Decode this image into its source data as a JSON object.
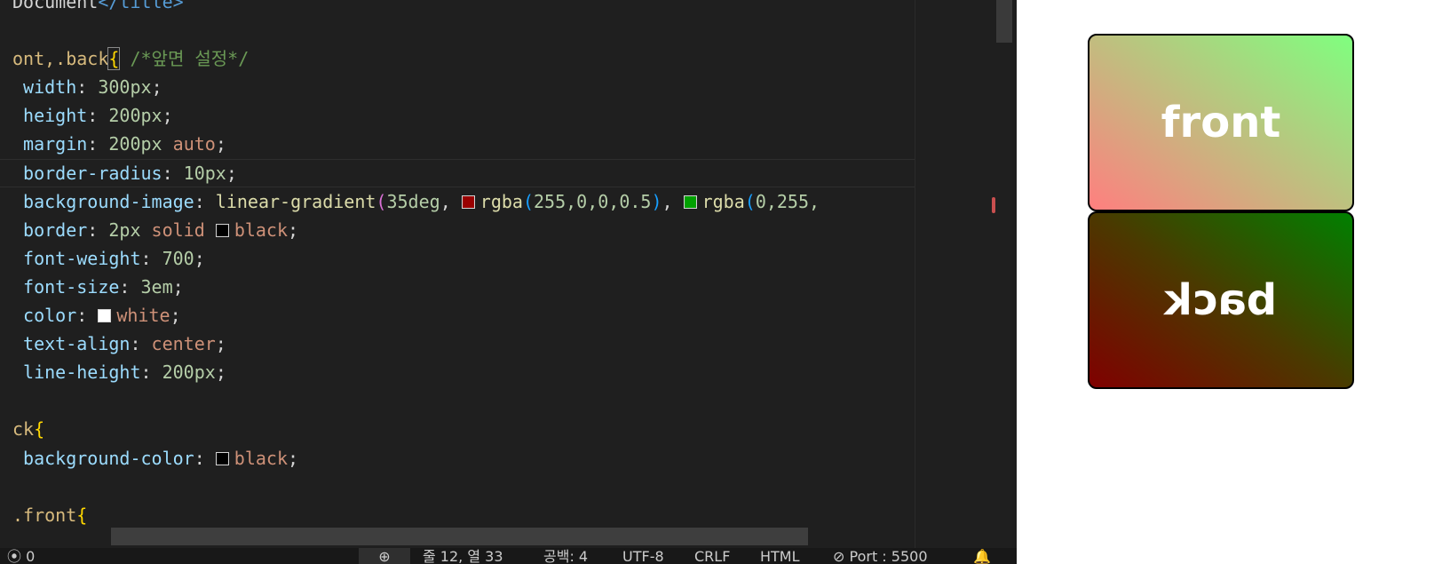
{
  "editor": {
    "lines": [
      {
        "id": "title",
        "tokens": [
          {
            "t": "Document",
            "c": "txt"
          },
          {
            "t": "</",
            "c": "tag"
          },
          {
            "t": "title",
            "c": "tag"
          },
          {
            "t": ">",
            "c": "tag"
          }
        ]
      },
      {
        "id": "blank1",
        "tokens": []
      },
      {
        "id": "sel-front-back",
        "tokens": [
          {
            "t": "ont,.back",
            "c": "sel"
          },
          {
            "t": "{",
            "c": "br1 bracket-match"
          },
          {
            "t": " /*앞면 설정*/",
            "c": "cmt"
          }
        ]
      },
      {
        "id": "width",
        "tokens": [
          {
            "t": " width",
            "c": "prop"
          },
          {
            "t": ": ",
            "c": "txt"
          },
          {
            "t": "300px",
            "c": "num"
          },
          {
            "t": ";",
            "c": "txt"
          }
        ]
      },
      {
        "id": "height",
        "tokens": [
          {
            "t": " height",
            "c": "prop"
          },
          {
            "t": ": ",
            "c": "txt"
          },
          {
            "t": "200px",
            "c": "num"
          },
          {
            "t": ";",
            "c": "txt"
          }
        ]
      },
      {
        "id": "margin",
        "tokens": [
          {
            "t": " margin",
            "c": "prop"
          },
          {
            "t": ": ",
            "c": "txt"
          },
          {
            "t": "200px",
            "c": "num"
          },
          {
            "t": " auto",
            "c": "kw"
          },
          {
            "t": ";",
            "c": "txt"
          }
        ]
      },
      {
        "id": "border-radius",
        "current": true,
        "tokens": [
          {
            "t": " border-radius",
            "c": "prop"
          },
          {
            "t": ": ",
            "c": "txt"
          },
          {
            "t": "10px",
            "c": "num"
          },
          {
            "t": ";",
            "c": "txt"
          }
        ]
      },
      {
        "id": "background-image",
        "tokens": [
          {
            "t": " background-image",
            "c": "prop"
          },
          {
            "t": ": ",
            "c": "txt"
          },
          {
            "t": "linear-gradient",
            "c": "fn"
          },
          {
            "t": "(",
            "c": "br2"
          },
          {
            "t": "35deg",
            "c": "num"
          },
          {
            "t": ", ",
            "c": "txt"
          },
          {
            "swatch": "#990000"
          },
          {
            "t": "rgba",
            "c": "fn"
          },
          {
            "t": "(",
            "c": "br3"
          },
          {
            "t": "255,0,0,0.5",
            "c": "num"
          },
          {
            "t": ")",
            "c": "br3"
          },
          {
            "t": ", ",
            "c": "txt"
          },
          {
            "swatch": "#00a000"
          },
          {
            "t": "rgba",
            "c": "fn"
          },
          {
            "t": "(",
            "c": "br3"
          },
          {
            "t": "0,255,",
            "c": "num"
          }
        ]
      },
      {
        "id": "border",
        "tokens": [
          {
            "t": " border",
            "c": "prop"
          },
          {
            "t": ": ",
            "c": "txt"
          },
          {
            "t": "2px",
            "c": "num"
          },
          {
            "t": " solid ",
            "c": "kw"
          },
          {
            "swatch": "#000000"
          },
          {
            "t": "black",
            "c": "kw"
          },
          {
            "t": ";",
            "c": "txt"
          }
        ]
      },
      {
        "id": "font-weight",
        "tokens": [
          {
            "t": " font-weight",
            "c": "prop"
          },
          {
            "t": ": ",
            "c": "txt"
          },
          {
            "t": "700",
            "c": "num"
          },
          {
            "t": ";",
            "c": "txt"
          }
        ]
      },
      {
        "id": "font-size",
        "tokens": [
          {
            "t": " font-size",
            "c": "prop"
          },
          {
            "t": ": ",
            "c": "txt"
          },
          {
            "t": "3em",
            "c": "num"
          },
          {
            "t": ";",
            "c": "txt"
          }
        ]
      },
      {
        "id": "color",
        "tokens": [
          {
            "t": " color",
            "c": "prop"
          },
          {
            "t": ": ",
            "c": "txt"
          },
          {
            "swatch": "#ffffff"
          },
          {
            "t": "white",
            "c": "kw"
          },
          {
            "t": ";",
            "c": "txt"
          }
        ]
      },
      {
        "id": "text-align",
        "tokens": [
          {
            "t": " text-align",
            "c": "prop"
          },
          {
            "t": ": ",
            "c": "txt"
          },
          {
            "t": "center",
            "c": "kw"
          },
          {
            "t": ";",
            "c": "txt"
          }
        ]
      },
      {
        "id": "line-height",
        "tokens": [
          {
            "t": " line-height",
            "c": "prop"
          },
          {
            "t": ": ",
            "c": "txt"
          },
          {
            "t": "200px",
            "c": "num"
          },
          {
            "t": ";",
            "c": "txt"
          }
        ]
      },
      {
        "id": "blank2",
        "tokens": []
      },
      {
        "id": "sel-back",
        "tokens": [
          {
            "t": "ck",
            "c": "sel"
          },
          {
            "t": "{",
            "c": "br1"
          }
        ]
      },
      {
        "id": "background-color",
        "tokens": [
          {
            "t": " background-color",
            "c": "prop"
          },
          {
            "t": ": ",
            "c": "txt"
          },
          {
            "swatch": "#000000"
          },
          {
            "t": "black",
            "c": "kw"
          },
          {
            "t": ";",
            "c": "txt"
          }
        ]
      },
      {
        "id": "blank3",
        "tokens": []
      },
      {
        "id": "sel-front",
        "tokens": [
          {
            "t": ".front",
            "c": "sel"
          },
          {
            "t": "{",
            "c": "br1"
          }
        ]
      }
    ]
  },
  "statusbar": {
    "remote": "⦿ 0",
    "zoom": "⊕",
    "position": "줄 12, 열 33",
    "spaces": "공백: 4",
    "encoding": "UTF-8",
    "eol": "CRLF",
    "language": "HTML",
    "port": "⊘ Port : 5500",
    "bell": "🔔"
  },
  "preview": {
    "front_text": "front",
    "back_text": "back"
  },
  "colors": {
    "editor_bg": "#1f1f1f",
    "statusbar_bg": "#181818",
    "preview_bg": "#ffffff"
  }
}
